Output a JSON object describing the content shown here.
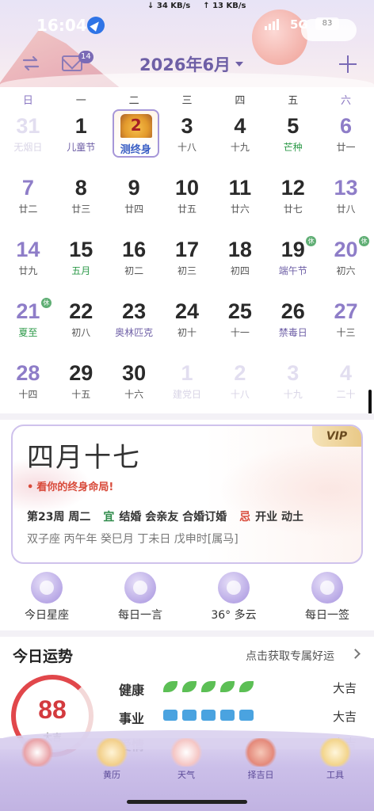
{
  "status_bar": {
    "time": "16:04",
    "download": "↓ 34 KB/s",
    "upload": "↑ 13 KB/s",
    "network": "5G",
    "battery": "83"
  },
  "toolbar": {
    "mail_badge": "14",
    "month_title": "2026年6月"
  },
  "weekdays": [
    "日",
    "一",
    "二",
    "三",
    "四",
    "五",
    "六"
  ],
  "calendar": {
    "today_label": "测终身",
    "rest_mark": "休",
    "rows": [
      [
        {
          "n": "31",
          "s": "无烟日"
        },
        {
          "n": "1",
          "s": "儿童节"
        },
        {
          "n": "2",
          "s": "测终身"
        },
        {
          "n": "3",
          "s": "十八"
        },
        {
          "n": "4",
          "s": "十九"
        },
        {
          "n": "5",
          "s": "芒种"
        },
        {
          "n": "6",
          "s": "廿一"
        }
      ],
      [
        {
          "n": "7",
          "s": "廿二"
        },
        {
          "n": "8",
          "s": "廿三"
        },
        {
          "n": "9",
          "s": "廿四"
        },
        {
          "n": "10",
          "s": "廿五"
        },
        {
          "n": "11",
          "s": "廿六"
        },
        {
          "n": "12",
          "s": "廿七"
        },
        {
          "n": "13",
          "s": "廿八"
        }
      ],
      [
        {
          "n": "14",
          "s": "廿九"
        },
        {
          "n": "15",
          "s": "五月"
        },
        {
          "n": "16",
          "s": "初二"
        },
        {
          "n": "17",
          "s": "初三"
        },
        {
          "n": "18",
          "s": "初四"
        },
        {
          "n": "19",
          "s": "端午节"
        },
        {
          "n": "20",
          "s": "初六"
        }
      ],
      [
        {
          "n": "21",
          "s": "夏至"
        },
        {
          "n": "22",
          "s": "初八"
        },
        {
          "n": "23",
          "s": "奥林匹克"
        },
        {
          "n": "24",
          "s": "初十"
        },
        {
          "n": "25",
          "s": "十一"
        },
        {
          "n": "26",
          "s": "禁毒日"
        },
        {
          "n": "27",
          "s": "十三"
        }
      ],
      [
        {
          "n": "28",
          "s": "十四"
        },
        {
          "n": "29",
          "s": "十五"
        },
        {
          "n": "30",
          "s": "十六"
        },
        {
          "n": "1",
          "s": "建党日"
        },
        {
          "n": "2",
          "s": "十八"
        },
        {
          "n": "3",
          "s": "十九"
        },
        {
          "n": "4",
          "s": "二十"
        }
      ]
    ]
  },
  "lunar_card": {
    "vip": "VIP",
    "lunar_date": "四月十七",
    "fortune_link": "看你的终身命局!",
    "week_info": "第23周 周二",
    "yi_label": "宜",
    "yi_items": "结婚 会亲友 合婚订婚",
    "ji_label": "忌",
    "ji_items": "开业 动土",
    "ganzhi": "双子座  丙午年 癸巳月 丁未日  戊申时[属马]"
  },
  "shortcuts": [
    {
      "label": "今日星座"
    },
    {
      "label": "每日一言"
    },
    {
      "label": "36° 多云"
    },
    {
      "label": "每日一签"
    }
  ],
  "fortune": {
    "title": "今日运势",
    "link": "点击获取专属好运",
    "score": "88",
    "level": "大吉",
    "rows": [
      {
        "key": "健康",
        "value": "大吉"
      },
      {
        "key": "事业",
        "value": "大吉"
      },
      {
        "key": "爱情",
        "value": "大吉"
      }
    ]
  },
  "tabbar": [
    {
      "label": ""
    },
    {
      "label": "黄历"
    },
    {
      "label": "天气"
    },
    {
      "label": "择吉日"
    },
    {
      "label": "工具"
    }
  ]
}
